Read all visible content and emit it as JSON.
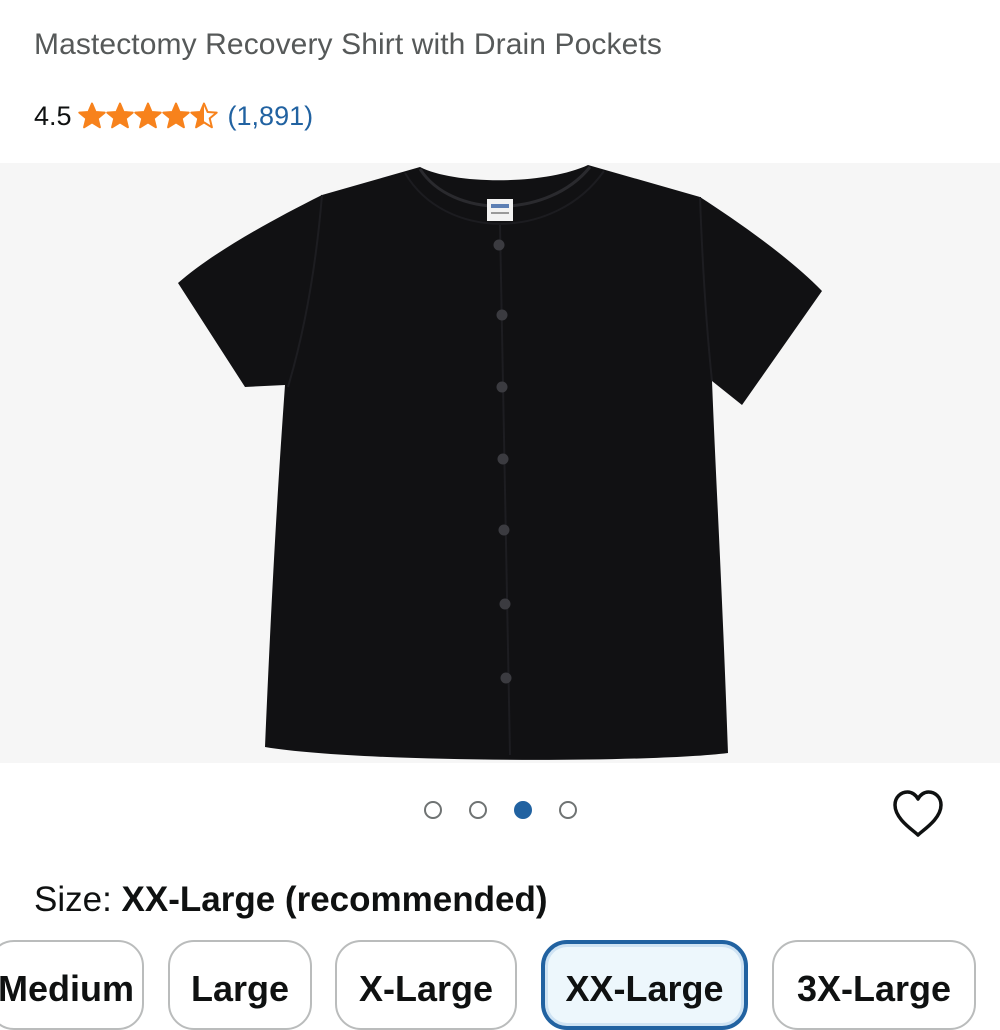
{
  "product": {
    "title": "Mastectomy Recovery Shirt with Drain Pockets",
    "rating_value": "4.5",
    "rating": 4.5,
    "max_rating": 5,
    "review_count": "(1,891)"
  },
  "carousel": {
    "image_icon": "black-shirt-product-image",
    "slide_count": 4,
    "active_index": 2
  },
  "wishlist": {
    "icon": "heart-icon"
  },
  "size": {
    "label": "Size:",
    "selected": "XX-Large (recommended)",
    "options": [
      {
        "label": "Medium",
        "selected": false
      },
      {
        "label": "Large",
        "selected": false
      },
      {
        "label": "X-Large",
        "selected": false
      },
      {
        "label": "XX-Large",
        "selected": true
      },
      {
        "label": "3X-Large",
        "selected": false
      }
    ]
  },
  "colors": {
    "star": "#f7821c",
    "link": "#2162a1",
    "accent_border": "#2162a1",
    "selected_bg": "#edf7fc"
  }
}
